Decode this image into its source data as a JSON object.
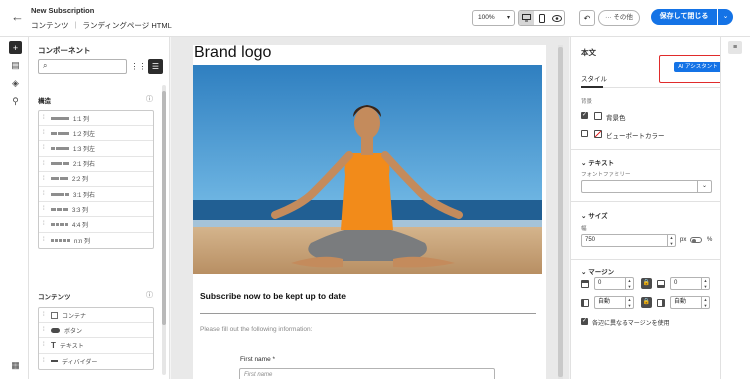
{
  "header": {
    "title": "New Subscription",
    "crumb_1": "コンテンツ",
    "crumb_2": "ランディングページ HTML",
    "zoom": "100%",
    "more_label": "その他",
    "save_label": "保存して閉じる"
  },
  "components": {
    "title": "コンポーネント",
    "search_placeholder": "",
    "structure_title": "構造",
    "structure_items": [
      "1:1 列",
      "1:2 列左",
      "1:3 列左",
      "2:1 列右",
      "2:2 列",
      "3:1 列右",
      "3:3 列",
      "4:4 列",
      "n:n 列"
    ],
    "content_title": "コンテンツ",
    "content_items": [
      "コンテナ",
      "ボタン",
      "テキスト",
      "ディバイダー"
    ]
  },
  "canvas": {
    "brand": "Brand logo",
    "subhead": "Subscribe now to be kept up to date",
    "fillout": "Please fill out the following information:",
    "first_name_label": "First name",
    "first_name_req": "*",
    "first_name_placeholder": "First name"
  },
  "props": {
    "title": "本文",
    "ai_label": "AI アシスタント",
    "tab_style": "スタイル",
    "bg_label": "背景",
    "bg_color": "背景色",
    "viewport_color": "ビューポートカラー",
    "text_section": "テキスト",
    "font_family_label": "フォントファミリー",
    "size_section": "サイズ",
    "width_label": "幅",
    "width_value": "750",
    "unit_px": "px",
    "unit_pct": "%",
    "margin_section": "マージン",
    "margin_top": "0",
    "margin_bottom": "0",
    "margin_left": "自動",
    "margin_right": "自動",
    "diff_margin_label": "各辺に異なるマージンを使用"
  },
  "colors": {
    "accent": "#1473e6",
    "highlight": "#e02b2b"
  }
}
